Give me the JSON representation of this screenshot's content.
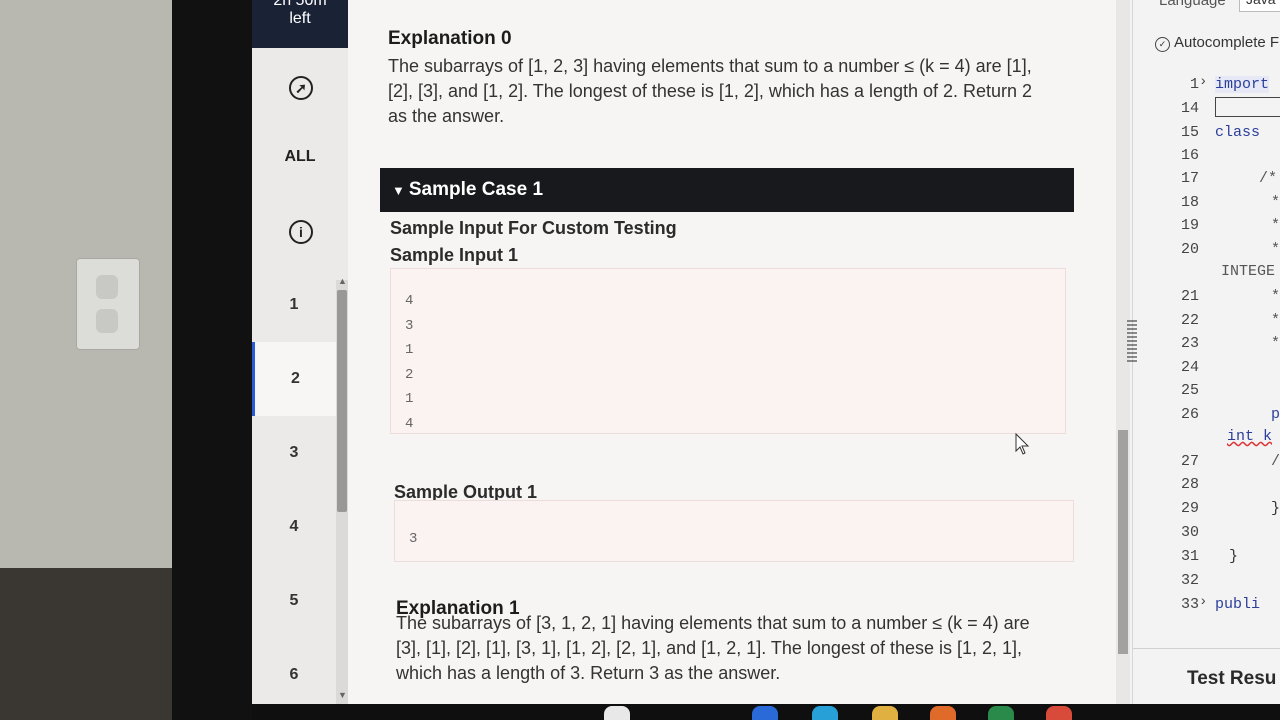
{
  "timer": {
    "line1": "2h 50m",
    "line2": "left"
  },
  "nav": {
    "all_label": "ALL",
    "questions": [
      "1",
      "2",
      "3",
      "4",
      "5",
      "6"
    ],
    "active_question": "2"
  },
  "problem": {
    "explanation0": {
      "title": "Explanation 0",
      "line1": "The subarrays of [1, 2, 3] having elements that sum to a number ≤ (k = 4) are [1],",
      "line2": "[2], [3], and [1, 2]. The longest of these is [1, 2], which has a length of 2. Return 2",
      "line3": "as the answer."
    },
    "sample_case": {
      "header": "Sample Case 1",
      "custom_testing_label": "Sample Input For Custom Testing",
      "input_label": "Sample Input 1",
      "input_lines": [
        "4",
        "3",
        "1",
        "2",
        "1",
        "4"
      ],
      "output_label": "Sample Output 1",
      "output_lines": [
        "3"
      ]
    },
    "explanation1": {
      "title": "Explanation 1",
      "line1": "The subarrays of [3, 1, 2, 1] having elements that sum to a number ≤ (k = 4) are",
      "line2": "[3], [1], [2], [1], [3, 1], [1, 2], [2, 1], and [1, 2, 1]. The longest of these is [1, 2, 1],",
      "line3": "which has a length of 3. Return 3 as the answer."
    }
  },
  "editor": {
    "language_label": "Language",
    "language_value": "Java",
    "autocomplete_label": "Autocomplete F",
    "line_numbers": [
      "1",
      "14",
      "15",
      "16",
      "17",
      "18",
      "19",
      "20",
      "21",
      "22",
      "23",
      "24",
      "25",
      "26",
      "27",
      "28",
      "29",
      "30",
      "31",
      "32",
      "33"
    ],
    "code_fragments": {
      "l1": "import",
      "l15": "class",
      "l17": "/*",
      "star": "*",
      "integer": "INTEGE",
      "pu": "pu",
      "intk": "int k",
      "slash": "/",
      "brace": "}",
      "brace31": "}",
      "publi": "publi"
    },
    "test_results_label": "Test Resu"
  },
  "colors": {
    "nav_dark": "#1a2236",
    "case_header": "#17191d",
    "active_accent": "#2a5bd7",
    "code_keyword": "#2b3f9a"
  }
}
